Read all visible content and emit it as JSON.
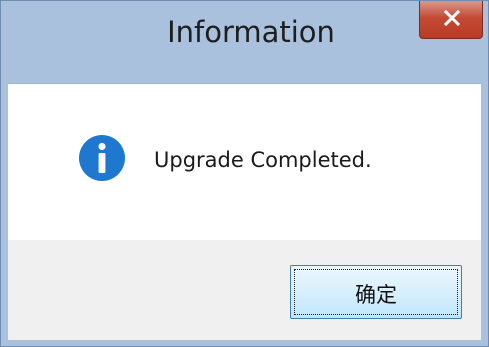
{
  "dialog": {
    "title": "Information",
    "message": "Upgrade Completed.",
    "ok_label": "确定",
    "close_icon": "close-icon",
    "info_icon": "info-icon"
  },
  "colors": {
    "info_blue": "#1e78cf",
    "close_red": "#c44a34",
    "frame": "#a9c1dd"
  }
}
